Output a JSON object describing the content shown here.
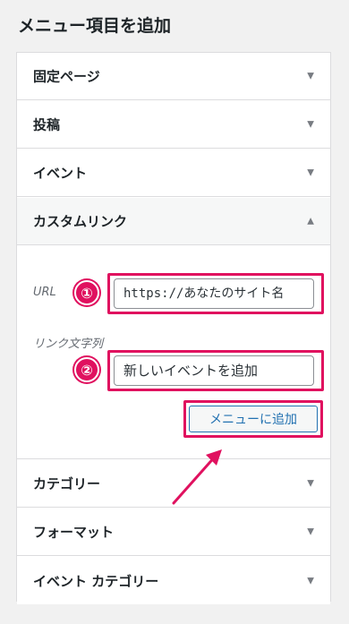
{
  "heading": "メニュー項目を追加",
  "sections_top": [
    {
      "label": "固定ページ",
      "arrow": "▼"
    },
    {
      "label": "投稿",
      "arrow": "▼"
    },
    {
      "label": "イベント",
      "arrow": "▼"
    }
  ],
  "custom_link": {
    "label": "カスタムリンク",
    "arrow": "▲",
    "url_label": "URL",
    "url_value": "https://あなたのサイト名",
    "link_text_label": "リンク文字列",
    "link_text_value": "新しいイベントを追加",
    "add_button": "メニューに追加",
    "badge_1": "①",
    "badge_2": "②"
  },
  "sections_bottom": [
    {
      "label": "カテゴリー",
      "arrow": "▼"
    },
    {
      "label": "フォーマット",
      "arrow": "▼"
    },
    {
      "label": "イベント カテゴリー",
      "arrow": "▼"
    }
  ],
  "colors": {
    "highlight": "#e0115f",
    "accent": "#2271b1"
  }
}
